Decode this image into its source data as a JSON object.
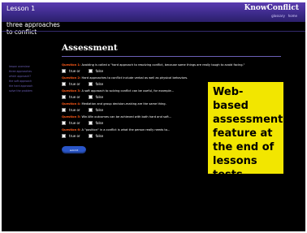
{
  "header": {
    "lesson": "Lesson 1",
    "logo": "KnowConflict",
    "links": [
      "glossary",
      "home"
    ]
  },
  "subtitle": "three approaches to conflict",
  "sidenav": [
    "lesson overview",
    "three approaches",
    "which approach?",
    "the soft approach",
    "the hard approach",
    "solve the problem"
  ],
  "assessment": {
    "title": "Assessment",
    "questions": [
      {
        "number": "Question 1:",
        "text": "Avoiding is called a \"hard approach to resolving conflict, because some things are really tough to avoid facing.\"",
        "options": [
          "true or",
          "false"
        ]
      },
      {
        "number": "Question 2:",
        "text": "Hard approaches to conflict include verbal as well as physical behaviors.",
        "options": [
          "true or",
          "false"
        ]
      },
      {
        "number": "Question 3:",
        "text": "A soft approach to solving conflict can be useful, for example...",
        "options": [
          "true or",
          "false"
        ]
      },
      {
        "number": "Question 4:",
        "text": "Mediation and group decision-making are the same thing.",
        "options": [
          "true or",
          "false"
        ]
      },
      {
        "number": "Question 5:",
        "text": "Win-Win outcomes can be achieved with both hard and soft...",
        "options": [
          "true or",
          "false"
        ]
      },
      {
        "number": "Question 6:",
        "text": "A \"position\" in a conflict is what the person really needs to...",
        "options": [
          "true or",
          "false"
        ]
      }
    ],
    "submit": "submit"
  },
  "callout": "Web-based assessment feature at the end of lessons tests knowledge."
}
